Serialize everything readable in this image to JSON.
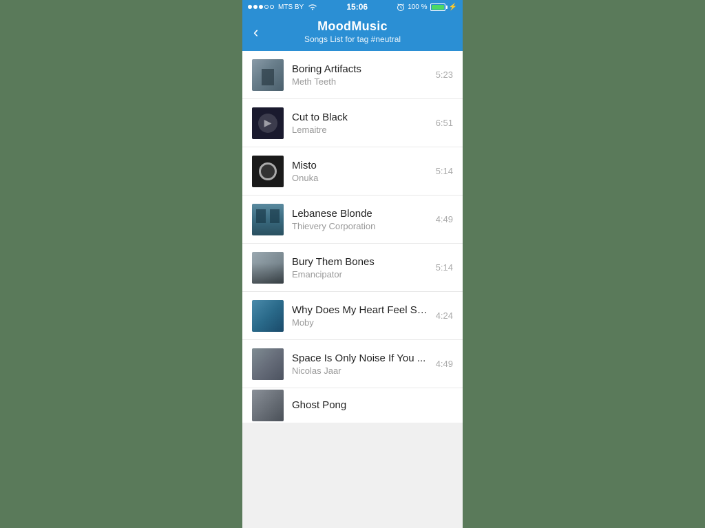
{
  "statusBar": {
    "carrier": "MTS BY",
    "time": "15:06",
    "battery": "100 %",
    "signal_dots": [
      "filled",
      "filled",
      "filled",
      "empty",
      "empty"
    ]
  },
  "header": {
    "back_label": "‹",
    "title": "MoodMusic",
    "subtitle": "Songs List for tag #neutral"
  },
  "songs": [
    {
      "id": 1,
      "title": "Boring Artifacts",
      "artist": "Meth Teeth",
      "duration": "5:23",
      "artwork_class": "artwork-1"
    },
    {
      "id": 2,
      "title": "Cut to Black",
      "artist": "Lemaitre",
      "duration": "6:51",
      "artwork_class": "artwork-2"
    },
    {
      "id": 3,
      "title": "Misto",
      "artist": "Onuka",
      "duration": "5:14",
      "artwork_class": "artwork-3"
    },
    {
      "id": 4,
      "title": "Lebanese Blonde",
      "artist": "Thievery Corporation",
      "duration": "4:49",
      "artwork_class": "artwork-4"
    },
    {
      "id": 5,
      "title": "Bury Them Bones",
      "artist": "Emancipator",
      "duration": "5:14",
      "artwork_class": "artwork-5"
    },
    {
      "id": 6,
      "title": "Why Does My Heart Feel So ...",
      "artist": "Moby",
      "duration": "4:24",
      "artwork_class": "artwork-6"
    },
    {
      "id": 7,
      "title": "Space Is Only Noise If You ...",
      "artist": "Nicolas Jaar",
      "duration": "4:49",
      "artwork_class": "artwork-7"
    },
    {
      "id": 8,
      "title": "Ghost Pong",
      "artist": "",
      "duration": "",
      "artwork_class": "artwork-8"
    }
  ]
}
